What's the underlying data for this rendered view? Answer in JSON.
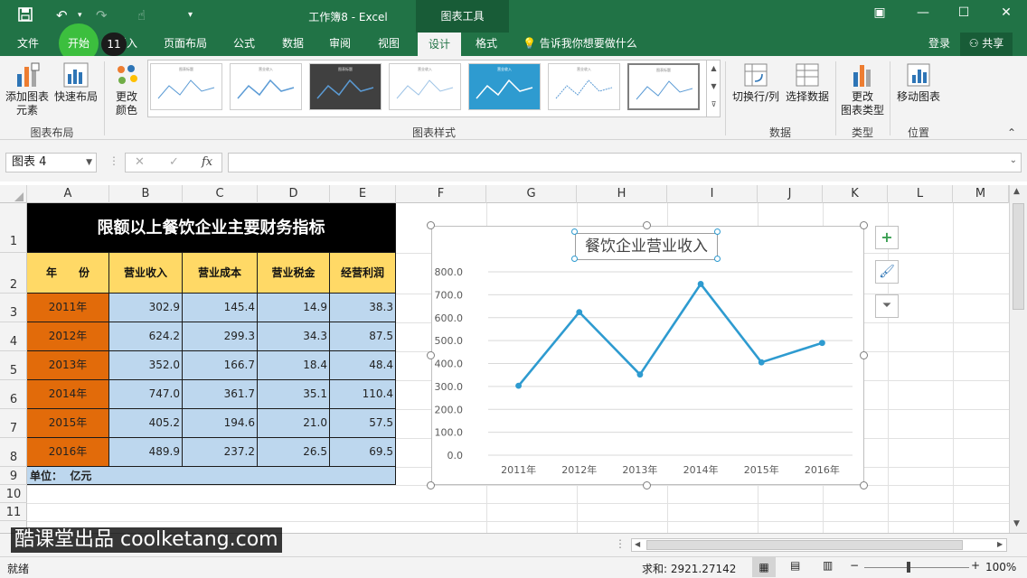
{
  "window": {
    "title": "工作簿8 - Excel",
    "context_tab": "图表工具"
  },
  "tabs": [
    {
      "label": "文件"
    },
    {
      "label": "开始"
    },
    {
      "label": "插入"
    },
    {
      "label": "页面布局"
    },
    {
      "label": "公式"
    },
    {
      "label": "数据"
    },
    {
      "label": "审阅"
    },
    {
      "label": "视图"
    },
    {
      "label": "设计"
    },
    {
      "label": "格式"
    }
  ],
  "tell_me": "告诉我你想要做什么",
  "signin": "登录",
  "share": "共享",
  "kb_badge": "11",
  "ribbon": {
    "add_element_1": "添加图表",
    "add_element_2": "元素",
    "quick_layout": "快速布局",
    "change_color_1": "更改",
    "change_color_2": "颜色",
    "group_layout": "图表布局",
    "group_styles": "图表样式",
    "switch_row_col": "切换行/列",
    "select_data": "选择数据",
    "group_data": "数据",
    "change_type_1": "更改",
    "change_type_2": "图表类型",
    "group_type": "类型",
    "move_chart": "移动图表",
    "group_location": "位置",
    "style_thumb_titles": [
      "图表标题",
      "营业收入",
      "图表标题",
      "营业收入",
      "营业收入",
      "营业收入",
      "图表标题"
    ]
  },
  "formula_bar": {
    "name_box": "图表 4",
    "cancel": "✕",
    "enter": "✓",
    "fx": "fx",
    "value": ""
  },
  "columns": [
    "A",
    "B",
    "C",
    "D",
    "E",
    "F",
    "G",
    "H",
    "I",
    "J",
    "K",
    "L",
    "M"
  ],
  "rows": [
    "1",
    "2",
    "3",
    "4",
    "5",
    "6",
    "7",
    "8",
    "9",
    "10",
    "11"
  ],
  "table": {
    "title": "限额以上餐饮企业主要财务指标",
    "headers": [
      "年　　份",
      "营业收入",
      "营业成本",
      "营业税金",
      "经营利润"
    ],
    "rows": [
      [
        "2011年",
        "302.9",
        "145.4",
        "14.9",
        "38.3"
      ],
      [
        "2012年",
        "624.2",
        "299.3",
        "34.3",
        "87.5"
      ],
      [
        "2013年",
        "352.0",
        "166.7",
        "18.4",
        "48.4"
      ],
      [
        "2014年",
        "747.0",
        "361.7",
        "35.1",
        "110.4"
      ],
      [
        "2015年",
        "405.2",
        "194.6",
        "21.0",
        "57.5"
      ],
      [
        "2016年",
        "489.9",
        "237.2",
        "26.5",
        "69.5"
      ]
    ],
    "unit": "单位：  亿元"
  },
  "chart_data": {
    "type": "line",
    "title": "餐饮企业营业收入",
    "categories": [
      "2011年",
      "2012年",
      "2013年",
      "2014年",
      "2015年",
      "2016年"
    ],
    "values": [
      302.9,
      624.2,
      352.0,
      747.0,
      405.2,
      489.9
    ],
    "ylim": [
      0,
      800
    ],
    "yticks": [
      "0.0",
      "100.0",
      "200.0",
      "300.0",
      "400.0",
      "500.0",
      "600.0",
      "700.0",
      "800.0"
    ],
    "grid": true,
    "color": "#2e9bd0"
  },
  "status": {
    "ready": "就绪",
    "sum": "求和: 2921.27142",
    "zoom": "100%"
  },
  "watermark": "酷课堂出品 coolketang.com"
}
